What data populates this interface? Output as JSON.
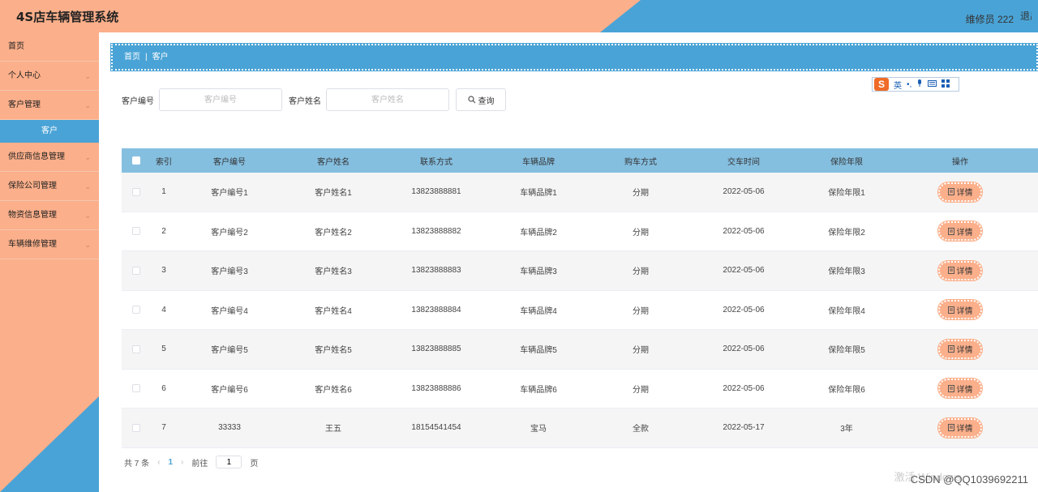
{
  "colors": {
    "accent_blue": "#4aa3d6",
    "accent_peach": "#fbaf8a",
    "header_blue": "#85bfe0"
  },
  "header": {
    "title": "4S店车辆管理系统",
    "user": "维修员 222",
    "logout": "退出"
  },
  "sidebar": {
    "items": [
      {
        "label": "首页",
        "chevron": false
      },
      {
        "label": "个人中心",
        "chevron": true
      },
      {
        "label": "客户管理",
        "chevron": true
      },
      {
        "label": "供应商信息管理",
        "chevron": true
      },
      {
        "label": "保险公司管理",
        "chevron": true
      },
      {
        "label": "物资信息管理",
        "chevron": true
      },
      {
        "label": "车辆维修管理",
        "chevron": true
      }
    ],
    "active_sub": "客户"
  },
  "breadcrumb": {
    "home": "首页",
    "sep": "|",
    "current": "客户"
  },
  "ime": {
    "logo": "S",
    "lang": "英",
    "icons": [
      "punct-icon",
      "mic-icon",
      "keyboard-icon",
      "grid-icon"
    ]
  },
  "search": {
    "field1_label": "客户编号",
    "field1_placeholder": "客户编号",
    "field2_label": "客户姓名",
    "field2_placeholder": "客户姓名",
    "button": "查询"
  },
  "table": {
    "headers": [
      "索引",
      "客户编号",
      "客户姓名",
      "联系方式",
      "车辆品牌",
      "购车方式",
      "交车时间",
      "保险年限",
      "操作"
    ],
    "detail_label": "详情",
    "rows": [
      [
        "1",
        "客户编号1",
        "客户姓名1",
        "13823888881",
        "车辆品牌1",
        "分期",
        "2022-05-06",
        "保险年限1"
      ],
      [
        "2",
        "客户编号2",
        "客户姓名2",
        "13823888882",
        "车辆品牌2",
        "分期",
        "2022-05-06",
        "保险年限2"
      ],
      [
        "3",
        "客户编号3",
        "客户姓名3",
        "13823888883",
        "车辆品牌3",
        "分期",
        "2022-05-06",
        "保险年限3"
      ],
      [
        "4",
        "客户编号4",
        "客户姓名4",
        "13823888884",
        "车辆品牌4",
        "分期",
        "2022-05-06",
        "保险年限4"
      ],
      [
        "5",
        "客户编号5",
        "客户姓名5",
        "13823888885",
        "车辆品牌5",
        "分期",
        "2022-05-06",
        "保险年限5"
      ],
      [
        "6",
        "客户编号6",
        "客户姓名6",
        "13823888886",
        "车辆品牌6",
        "分期",
        "2022-05-06",
        "保险年限6"
      ],
      [
        "7",
        "33333",
        "王五",
        "18154541454",
        "宝马",
        "全款",
        "2022-05-17",
        "3年"
      ]
    ]
  },
  "pager": {
    "total": "共 7 条",
    "prev": "‹",
    "page": "1",
    "next": "›",
    "goto": "前往",
    "goto_value": "1",
    "page_unit": "页"
  },
  "watermark": {
    "csdn": "CSDN @QQ1039692211",
    "windows": "激活 Windows"
  }
}
